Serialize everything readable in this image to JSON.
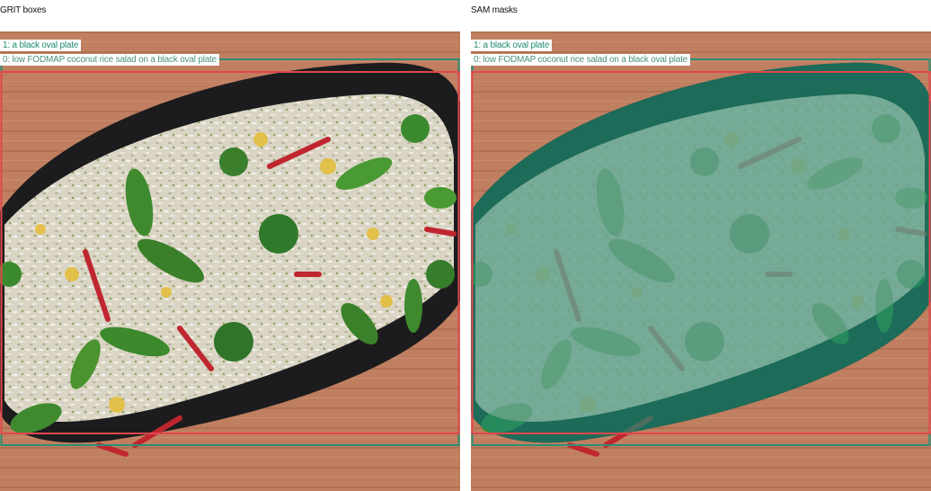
{
  "panels": {
    "left": {
      "title": "GRIT boxes",
      "labels": {
        "plate": "1: a black oval plate",
        "salad": "0: low FODMAP coconut rice salad on a black oval plate"
      }
    },
    "right": {
      "title": "SAM masks",
      "labels": {
        "plate": "1: a black oval plate",
        "salad": "0: low FODMAP coconut rice salad on a black oval plate"
      }
    }
  },
  "colors": {
    "plate_box": "#2a8f75",
    "salad_box": "#e0474c",
    "mask_fill": "#1f8a70",
    "wood": "#b9785a",
    "plate": "#1c1c1e"
  }
}
